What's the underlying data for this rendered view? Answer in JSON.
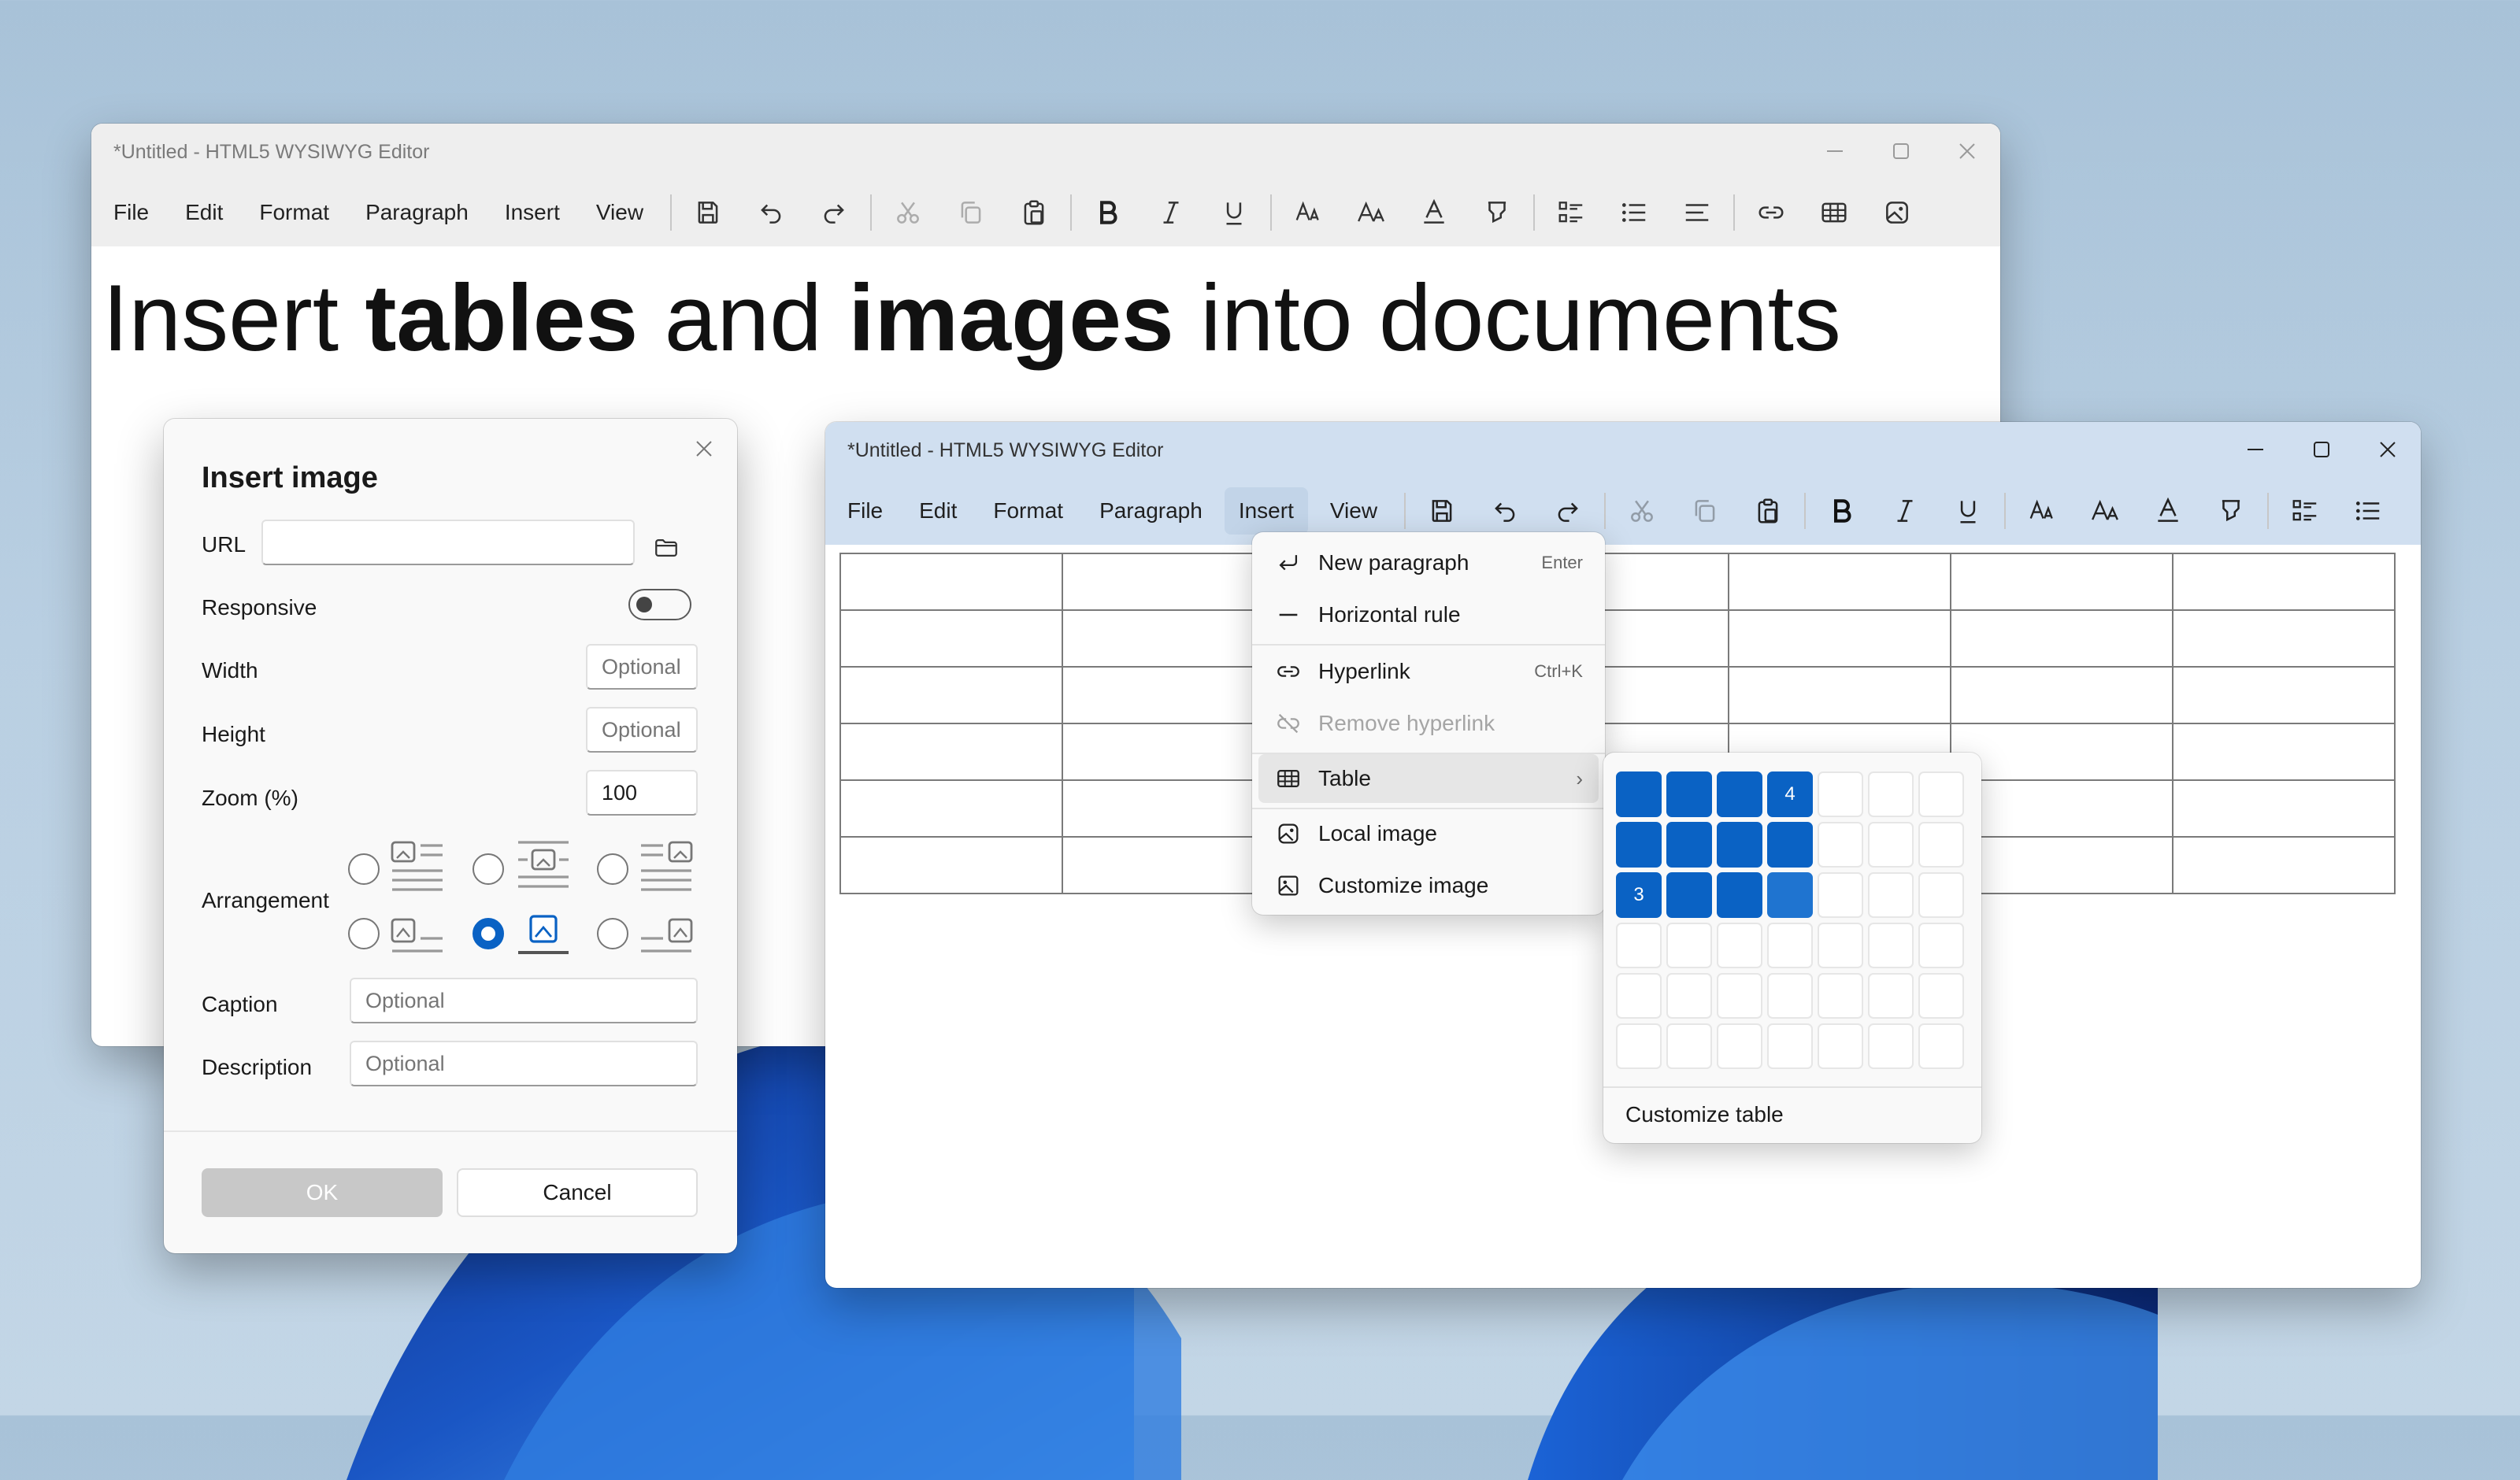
{
  "colors": {
    "accent": "#0a62c4",
    "desktop": "#b9cfe2",
    "bloom": "#1a56c4"
  },
  "back_window": {
    "title": "*Untitled - HTML5 WYSIWYG Editor",
    "menus": [
      "File",
      "Edit",
      "Format",
      "Paragraph",
      "Insert",
      "View"
    ],
    "heading": {
      "part1": "Insert ",
      "bold1": "tables",
      "part2": " and ",
      "bold2": "images",
      "part3": " into documents"
    }
  },
  "front_window": {
    "title": "*Untitled - HTML5 WYSIWYG Editor",
    "menus": [
      "File",
      "Edit",
      "Format",
      "Paragraph",
      "Insert",
      "View"
    ],
    "active_menu": "Insert",
    "document_table": {
      "rows": 6,
      "cols": 7
    }
  },
  "toolbar_icons": [
    "save-icon",
    "undo-icon",
    "redo-icon",
    "cut-icon",
    "copy-icon",
    "paste-icon",
    "bold-icon",
    "italic-icon",
    "underline-icon",
    "font-family-icon",
    "font-size-icon",
    "text-color-icon",
    "highlight-icon",
    "checklist-icon",
    "bullet-list-icon",
    "align-left-icon",
    "link-icon",
    "table-icon",
    "image-icon"
  ],
  "insert_menu": {
    "items": [
      {
        "label": "New paragraph",
        "shortcut": "Enter",
        "icon": "enter-icon"
      },
      {
        "label": "Horizontal rule",
        "shortcut": "",
        "icon": "horizontal-rule-icon"
      },
      {
        "label": "Hyperlink",
        "shortcut": "Ctrl+K",
        "icon": "link-icon"
      },
      {
        "label": "Remove hyperlink",
        "shortcut": "",
        "icon": "unlink-icon",
        "disabled": true
      },
      {
        "label": "Table",
        "shortcut": "",
        "icon": "table-icon",
        "submenu": true
      },
      {
        "label": "Local image",
        "shortcut": "",
        "icon": "local-image-icon"
      },
      {
        "label": "Customize image",
        "shortcut": "",
        "icon": "image-settings-icon"
      }
    ]
  },
  "table_picker": {
    "grid_rows": 6,
    "grid_cols": 7,
    "selected_cols": 4,
    "selected_rows": 3,
    "col_label": "4",
    "row_label": "3",
    "customize_label": "Customize table"
  },
  "insert_image_dialog": {
    "title": "Insert image",
    "url_label": "URL",
    "url_value": "",
    "responsive_label": "Responsive",
    "responsive_on": false,
    "width_label": "Width",
    "width_placeholder": "Optional",
    "height_label": "Height",
    "height_placeholder": "Optional",
    "zoom_label": "Zoom (%)",
    "zoom_value": "100",
    "arrangement_label": "Arrangement",
    "arrangement_selected": 5,
    "caption_label": "Caption",
    "caption_placeholder": "Optional",
    "description_label": "Description",
    "description_placeholder": "Optional",
    "ok_label": "OK",
    "cancel_label": "Cancel"
  }
}
